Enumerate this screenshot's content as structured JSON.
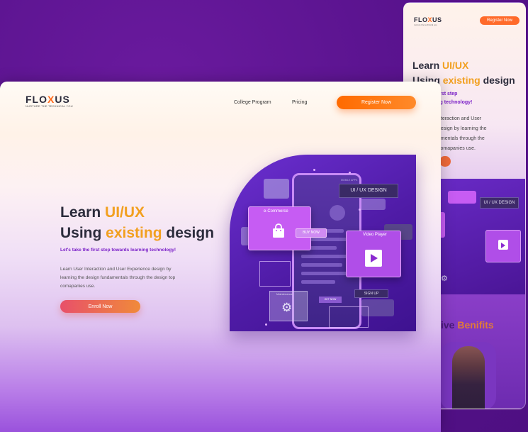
{
  "mobile": {
    "logo": {
      "pre": "FLO",
      "x": "X",
      "post": "US",
      "tagline": "nurture the technical you"
    },
    "register_label": "Register Now",
    "headline": {
      "line1_pre": "Learn ",
      "line1_accent": "UI/UX",
      "line2_pre": "Using ",
      "line2_accent": "existing",
      "line2_post": " design"
    },
    "subhead": "e first step\nning technology!",
    "description": "nteraction and User\ndesign by learning the\namentals through the\ncomapanies use.",
    "uiux_label": "UI / UX DESIGN",
    "benefits": {
      "pre": "ive ",
      "accent": "Benifits"
    }
  },
  "desktop": {
    "logo": {
      "pre": "FLO",
      "x": "X",
      "post": "US",
      "tagline": "NURTURE THE TECHNICAL YOU"
    },
    "nav": {
      "college": "College Program",
      "pricing": "Pricing"
    },
    "register_label": "Register Now",
    "headline": {
      "line1_pre": "Learn ",
      "line1_accent": "UI/UX",
      "line2_pre": "Using ",
      "line2_accent": "existing",
      "line2_post": " design"
    },
    "subhead": "Let's take the first step towards learning technology!",
    "description": "Learn User Interaction and User Experience design by learning the design fundamentals through the design top comapanies use.",
    "enroll_label": "Enroll Now",
    "hero": {
      "mobile_apps": "MOBILE APPS",
      "uiux": "UI / UX DESIGN",
      "ecommerce": "e-Commerce",
      "buy_now": "BUY NOW",
      "video_player": "Video Player",
      "maintenance": "Maintenance",
      "sign_up": "SIGN UP",
      "get_now": "GET NOW"
    }
  },
  "colors": {
    "accent_orange": "#f2a020",
    "brand_purple": "#7a1fc8",
    "register": "#ff6a00",
    "background": "#5a1590"
  },
  "icons": [
    "bag-icon",
    "play-icon",
    "gear-icon"
  ]
}
